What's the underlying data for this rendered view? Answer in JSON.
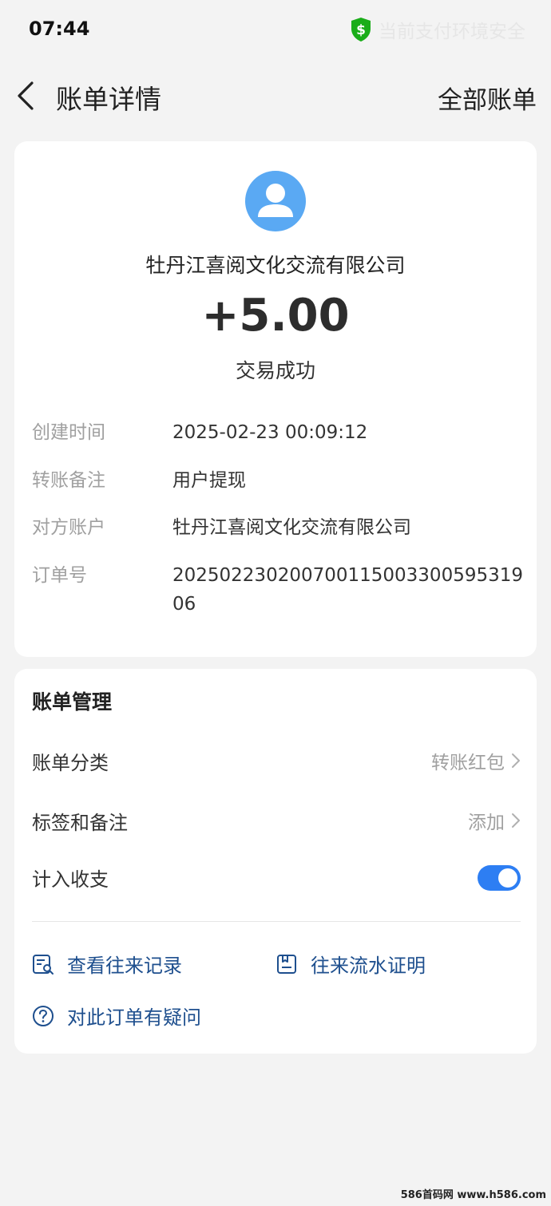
{
  "status_bar": {
    "time": "07:44",
    "security_text": "当前支付环境安全",
    "security_icon": "shield-dollar-icon",
    "security_color": "#1aad19"
  },
  "nav": {
    "title": "账单详情",
    "right_label": "全部账单"
  },
  "transaction": {
    "counterparty": "牡丹江喜阅文化交流有限公司",
    "amount": "+5.00",
    "status": "交易成功",
    "details": [
      {
        "label": "创建时间",
        "value": "2025-02-23 00:09:12"
      },
      {
        "label": "转账备注",
        "value": "用户提现"
      },
      {
        "label": "对方账户",
        "value": "牡丹江喜阅文化交流有限公司"
      },
      {
        "label": "订单号",
        "value": "20250223020070011500330059531906"
      }
    ]
  },
  "management": {
    "title": "账单管理",
    "category_label": "账单分类",
    "category_value": "转账红包",
    "tags_label": "标签和备注",
    "tags_value": "添加",
    "include_label": "计入收支",
    "include_enabled": true,
    "links": {
      "records": "查看往来记录",
      "proof": "往来流水证明",
      "question": "对此订单有疑问"
    }
  },
  "watermark": "586首码网 www.h586.com",
  "colors": {
    "accent": "#2d7ef3",
    "link": "#1e4f8e",
    "avatar": "#5aa9f3",
    "muted": "#a0a0a0"
  }
}
